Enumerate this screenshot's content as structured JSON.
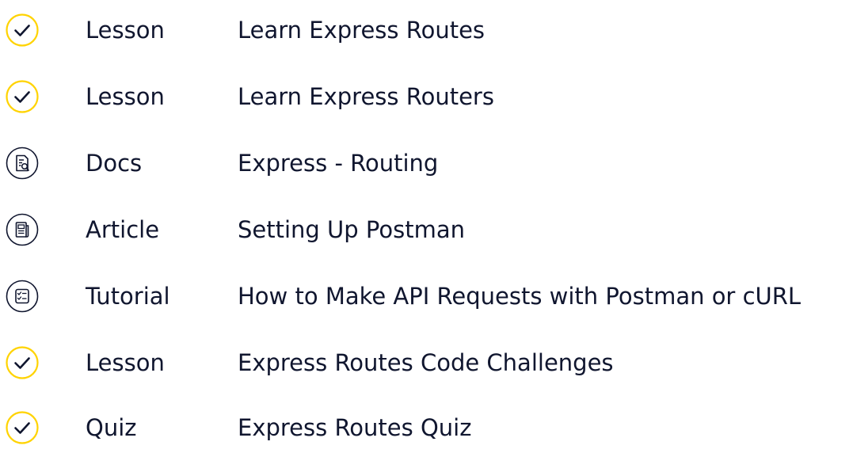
{
  "colors": {
    "text": "#10162f",
    "check_ring": "#ffd300",
    "neutral_ring": "#10162f"
  },
  "items": [
    {
      "type": "Lesson",
      "title": "Learn Express Routes",
      "icon": "check-icon",
      "completed": true
    },
    {
      "type": "Lesson",
      "title": "Learn Express Routers",
      "icon": "check-icon",
      "completed": true
    },
    {
      "type": "Docs",
      "title": "Express - Routing",
      "icon": "docs-search-icon",
      "completed": false
    },
    {
      "type": "Article",
      "title": "Setting Up Postman",
      "icon": "article-icon",
      "completed": false
    },
    {
      "type": "Tutorial",
      "title": "How to Make API Requests with Postman or cURL",
      "icon": "tutorial-checklist-icon",
      "completed": false
    },
    {
      "type": "Lesson",
      "title": "Express Routes Code Challenges",
      "icon": "check-icon",
      "completed": true
    },
    {
      "type": "Quiz",
      "title": "Express Routes Quiz",
      "icon": "check-icon",
      "completed": true
    }
  ]
}
